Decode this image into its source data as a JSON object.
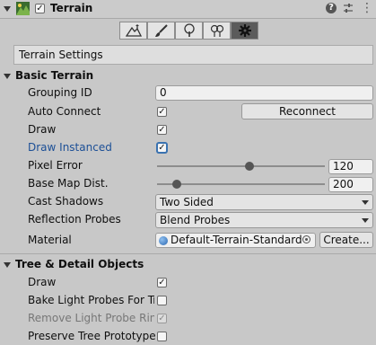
{
  "header": {
    "title": "Terrain",
    "enabled": true
  },
  "toolbar": {
    "tools": [
      {
        "name": "raise-lower-terrain",
        "active": false
      },
      {
        "name": "paint-texture",
        "active": false
      },
      {
        "name": "paint-trees",
        "active": false
      },
      {
        "name": "paint-details",
        "active": false
      },
      {
        "name": "terrain-settings",
        "active": true
      }
    ]
  },
  "settings_box": {
    "label": "Terrain Settings"
  },
  "basic_terrain": {
    "title": "Basic Terrain",
    "grouping_id": {
      "label": "Grouping ID",
      "value": "0"
    },
    "auto_connect": {
      "label": "Auto Connect",
      "checked": true,
      "reconnect_label": "Reconnect"
    },
    "draw": {
      "label": "Draw",
      "checked": true
    },
    "draw_instanced": {
      "label": "Draw Instanced",
      "checked": true
    },
    "pixel_error": {
      "label": "Pixel Error",
      "value": "120",
      "slider_fraction": 0.55
    },
    "base_map_dist": {
      "label": "Base Map Dist.",
      "value": "200",
      "slider_fraction": 0.12
    },
    "cast_shadows": {
      "label": "Cast Shadows",
      "selected": "Two Sided"
    },
    "reflection_probes": {
      "label": "Reflection Probes",
      "selected": "Blend Probes"
    },
    "material": {
      "label": "Material",
      "value": "Default-Terrain-Standard",
      "create_label": "Create..."
    }
  },
  "tree_detail": {
    "title": "Tree & Detail Objects",
    "draw": {
      "label": "Draw",
      "checked": true
    },
    "bake_light_probes": {
      "label": "Bake Light Probes For Tre",
      "checked": false
    },
    "remove_light_probe_ring": {
      "label": "Remove Light Probe Ring",
      "checked": true
    },
    "preserve_tree_prototype": {
      "label": "Preserve Tree Prototype",
      "checked": false
    }
  }
}
